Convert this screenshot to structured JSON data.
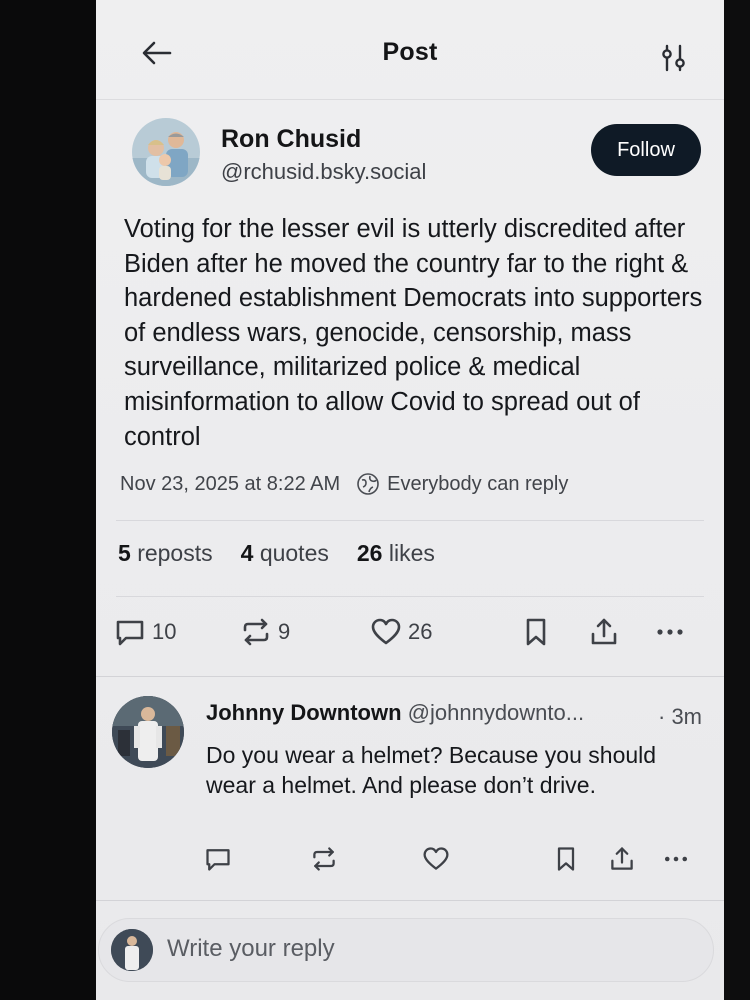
{
  "header": {
    "title": "Post"
  },
  "post": {
    "author_name": "Ron Chusid",
    "author_handle": "@rchusid.bsky.social",
    "follow_label": "Follow",
    "text": "Voting for the lesser evil is utterly discredited after Biden after he moved the country far to the right & hardened establishment Democrats into supporters of endless wars, genocide, censorship, mass surveillance, militarized police & medical misinformation to allow Covid to spread out of control",
    "date": "Nov 23, 2025 at 8:22 AM",
    "reply_setting": "Everybody can reply",
    "stats": {
      "reposts_count": "5",
      "reposts_label": "reposts",
      "quotes_count": "4",
      "quotes_label": "quotes",
      "likes_count": "26",
      "likes_label": "likes"
    },
    "actions": {
      "replies": "10",
      "reposts": "9",
      "likes": "26"
    }
  },
  "reply": {
    "author_name": "Johnny Downtown",
    "author_handle": "@johnnydownto...",
    "time": "· 3m",
    "text": "Do you wear a helmet?  Because you should wear a helmet.  And please don’t drive."
  },
  "composer": {
    "placeholder": "Write your reply"
  },
  "icons": {
    "back": "arrow-left-icon",
    "options": "sliders-icon",
    "globe": "globe-icon",
    "reply": "speech-bubble-icon",
    "repost": "repost-arrows-icon",
    "like": "heart-icon",
    "bookmark": "bookmark-icon",
    "share": "share-icon",
    "more": "ellipsis-icon"
  },
  "colors": {
    "follow_button": "#0f1a26",
    "background": "#ededef",
    "text": "#141517"
  }
}
